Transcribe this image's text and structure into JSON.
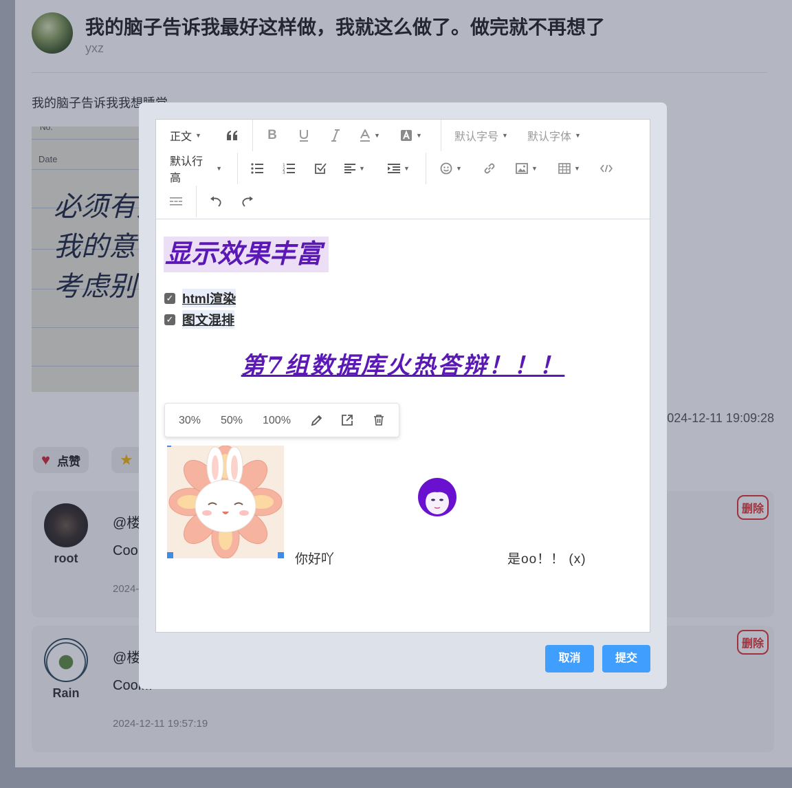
{
  "post": {
    "title": "我的脑子告诉我最好这样做，我就这么做了。做完就不再想了",
    "author": "yxz",
    "text": "我的脑子告诉我我想睡觉",
    "image_lines": [
      "必须有人",
      "我的意",
      "考虑别"
    ],
    "image_labels": [
      "No.",
      "Date"
    ],
    "time": "2024-12-11 19:09:28",
    "actions": [
      {
        "label": "点赞",
        "icon": "heart-icon"
      },
      {
        "label": "收藏",
        "icon": "star-icon"
      }
    ]
  },
  "comments": [
    {
      "name": "root",
      "at": "@楼",
      "body": "Coo",
      "time": "2024-",
      "delete_label": "删除"
    },
    {
      "name": "Rain",
      "at": "@楼",
      "body": "Cool!!!",
      "time": "2024-12-11 19:57:19",
      "delete_label": "删除"
    }
  ],
  "toolbar": {
    "paragraph": "正文",
    "font_size": "默认字号",
    "font_family": "默认字体",
    "line_height": "默认行高",
    "icons": [
      "quote-icon",
      "bold-icon",
      "underline-icon",
      "italic-icon",
      "font-color-icon",
      "bg-color-icon",
      "bulleted-list-icon",
      "numbered-list-icon",
      "todo-icon",
      "align-icon",
      "indent-icon",
      "emotion-icon",
      "link-icon",
      "image-icon",
      "table-icon",
      "code-icon",
      "divider-icon",
      "undo-icon",
      "redo-icon"
    ]
  },
  "content": {
    "heading": "显示效果丰富",
    "todos": [
      "html渲染",
      "图文混排"
    ],
    "banner": "第7组数据库火热答辩！！！",
    "image_toolbar": {
      "sizes": [
        "30%",
        "50%",
        "100%"
      ]
    },
    "hello": "你好吖",
    "caption": "是oo！！ (x)"
  },
  "buttons": {
    "cancel": "取消",
    "submit": "提交"
  },
  "colors": {
    "accent": "#409eff",
    "purple": "#5a18b4",
    "highlight": "#ecdff5",
    "delete": "#dd3333"
  }
}
